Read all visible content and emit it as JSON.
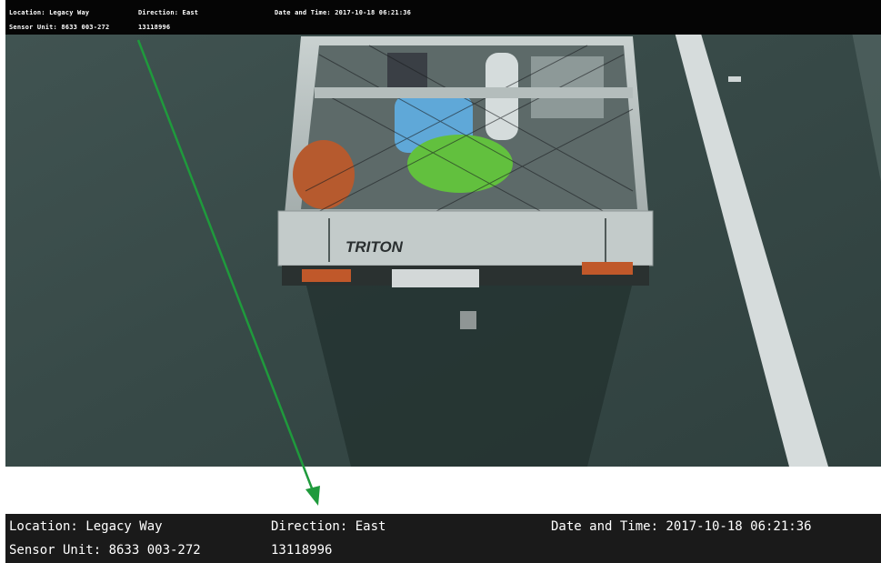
{
  "overlay": {
    "location": "Location: Legacy Way",
    "direction": "Direction: East",
    "datetime": "Date and Time: 2017-10-18 06:21:36",
    "sensor_unit": "Sensor Unit: 8633 003-272",
    "id": "13118996"
  },
  "vehicle": {
    "badge": "TRITON"
  },
  "zoom": {
    "location": "Location: Legacy Way",
    "direction": "Direction: East",
    "datetime": "Date and Time: 2017-10-18 06:21:36",
    "sensor_unit": "Sensor Unit: 8633 003-272",
    "id": "13118996"
  },
  "colors": {
    "arrow": "#1f9a3c",
    "road": "#3b4d4b",
    "lane_line": "#d8dede"
  }
}
